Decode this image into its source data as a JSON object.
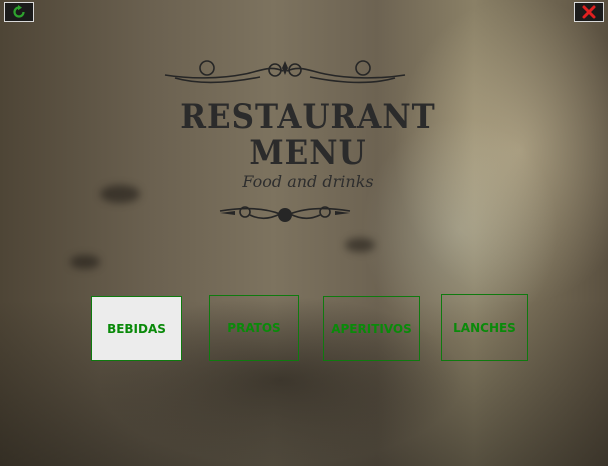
{
  "toolbar": {
    "refresh_icon": "refresh-icon",
    "close_icon": "close-icon",
    "accent": "#2ea32e",
    "close_color": "#e02020"
  },
  "logo": {
    "line1": "RESTAURANT",
    "line2": "MENU",
    "subtitle": "Food and drinks"
  },
  "menu": {
    "items": [
      {
        "label": "BEBIDAS",
        "selected": true
      },
      {
        "label": "PRATOS",
        "selected": false
      },
      {
        "label": "APERITIVOS",
        "selected": false
      },
      {
        "label": "LANCHES",
        "selected": false
      }
    ],
    "text_color": "#0a8a0a",
    "border_color": "#0f7a0f"
  }
}
